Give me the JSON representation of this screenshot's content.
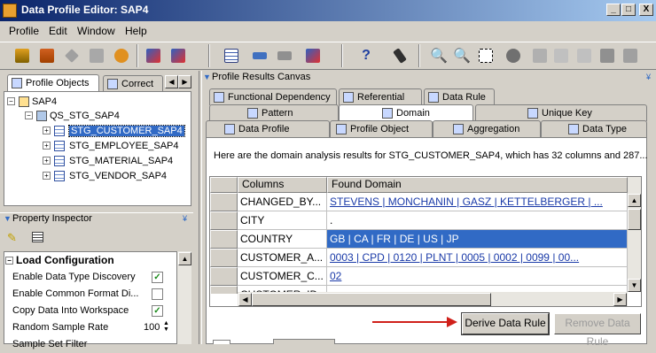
{
  "window": {
    "title": "Data Profile Editor: SAP4",
    "min": "_",
    "max": "□",
    "close": "X"
  },
  "menu": [
    "Profile",
    "Edit",
    "Window",
    "Help"
  ],
  "left_tabs": {
    "objects": "Profile Objects",
    "correct": "Correct"
  },
  "tree": {
    "root": "SAP4",
    "schema": "QS_STG_SAP4",
    "tables": [
      "STG_CUSTOMER_SAP4",
      "STG_EMPLOYEE_SAP4",
      "STG_MATERIAL_SAP4",
      "STG_VENDOR_SAP4"
    ],
    "selected": 0
  },
  "property_inspector": {
    "title": "Property Inspector",
    "section": "Load Configuration",
    "rows": [
      {
        "label": "Enable Data Type Discovery",
        "checked": true
      },
      {
        "label": "Enable Common Format Di...",
        "checked": false
      },
      {
        "label": "Copy Data Into Workspace",
        "checked": true
      }
    ],
    "sample_label": "Random Sample Rate",
    "sample_value": "100",
    "sample_filter": "Sample Set Filter"
  },
  "canvas": {
    "title": "Profile Results Canvas",
    "tabs_row1": [
      "Functional Dependency",
      "Referential",
      "Data Rule"
    ],
    "tabs_row2": [
      "Pattern",
      "Domain",
      "Unique Key"
    ],
    "tabs_row3": [
      "Data Profile",
      "Profile Object",
      "Aggregation",
      "Data Type"
    ],
    "info": "Here are the domain analysis results for STG_CUSTOMER_SAP4, which has 32 columns and 287...",
    "columns_header": "Columns",
    "domain_header": "Found Domain",
    "rows": [
      {
        "col": "CHANGED_BY...",
        "domain": "STEVENS  |  MONCHANIN  |  GASZ  |  KETTELBERGER  |  ..."
      },
      {
        "col": "CITY",
        "domain": "."
      },
      {
        "col": "COUNTRY",
        "domain": "GB  |  CA  |  FR  |  DE  |  US  |  JP"
      },
      {
        "col": "CUSTOMER_A...",
        "domain": "0003  |  CPD  |  0120  |  PLNT  |  0005  |  0002  |  0099  |  00..."
      },
      {
        "col": "CUSTOMER_C...",
        "domain": "02"
      },
      {
        "col": "CUSTOMER_ID",
        "domain": ""
      }
    ],
    "selected_row": 2,
    "buttons": {
      "derive": "Derive Data Rule",
      "remove": "Remove Data Rule"
    }
  },
  "colors": {
    "selection": "#316ac5",
    "link": "#1a3aa8",
    "title_grad_start": "#0a246a",
    "arrow": "#d0201a"
  }
}
